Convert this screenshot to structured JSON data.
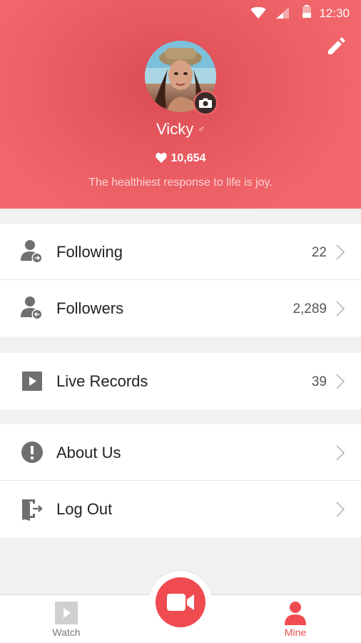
{
  "status": {
    "time": "12:30"
  },
  "profile": {
    "name": "Vicky",
    "gender_symbol": "♂",
    "likes": "10,654",
    "bio": "The healthiest response to life is joy."
  },
  "menu": {
    "following": {
      "label": "Following",
      "count": "22"
    },
    "followers": {
      "label": "Followers",
      "count": "2,289"
    },
    "live_records": {
      "label": "Live Records",
      "count": "39"
    },
    "about_us": {
      "label": "About Us"
    },
    "log_out": {
      "label": "Log Out"
    }
  },
  "tabs": {
    "watch": "Watch",
    "mine": "Mine"
  },
  "colors": {
    "accent": "#ef4b50",
    "header": "#f0666b",
    "icon_gray": "#6f6f6f"
  }
}
